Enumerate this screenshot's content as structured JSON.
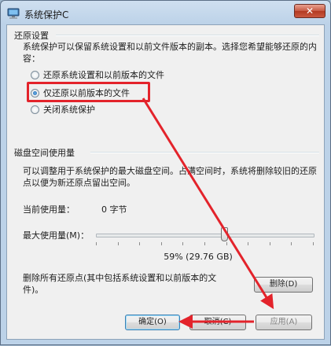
{
  "window": {
    "title": "系统保护C",
    "close_glyph": "✕"
  },
  "restore_settings": {
    "section_label": "还原设置",
    "description": "系统保护可以保留系统设置和以前文件版本的副本。选择您希望能够还原的内容：",
    "options": [
      {
        "label": "还原系统设置和以前版本的文件",
        "checked": false
      },
      {
        "label": "仅还原以前版本的文件",
        "checked": true
      },
      {
        "label": "关闭系统保护",
        "checked": false
      }
    ]
  },
  "disk_usage": {
    "section_label": "磁盘空间使用量",
    "description": "可以调整用于系统保护的最大磁盘空间。占满空间时，系统将删除较旧的还原点以便为新还原点留出空间。",
    "current_label": "当前使用量：",
    "current_value": "0 字节",
    "max_label": "最大使用量(M)：",
    "slider_fraction": 0.59,
    "max_value_text": "59% (29.76 GB)"
  },
  "delete_points": {
    "description": "删除所有还原点(其中包括系统设置和以前版本的文件)。",
    "button_label": "删除(D)"
  },
  "footer": {
    "ok_label": "确定(O)",
    "cancel_label": "取消(C)",
    "apply_label": "应用(A)"
  },
  "colors": {
    "annotation": "#e3232b",
    "accent": "#3c7fb1"
  }
}
